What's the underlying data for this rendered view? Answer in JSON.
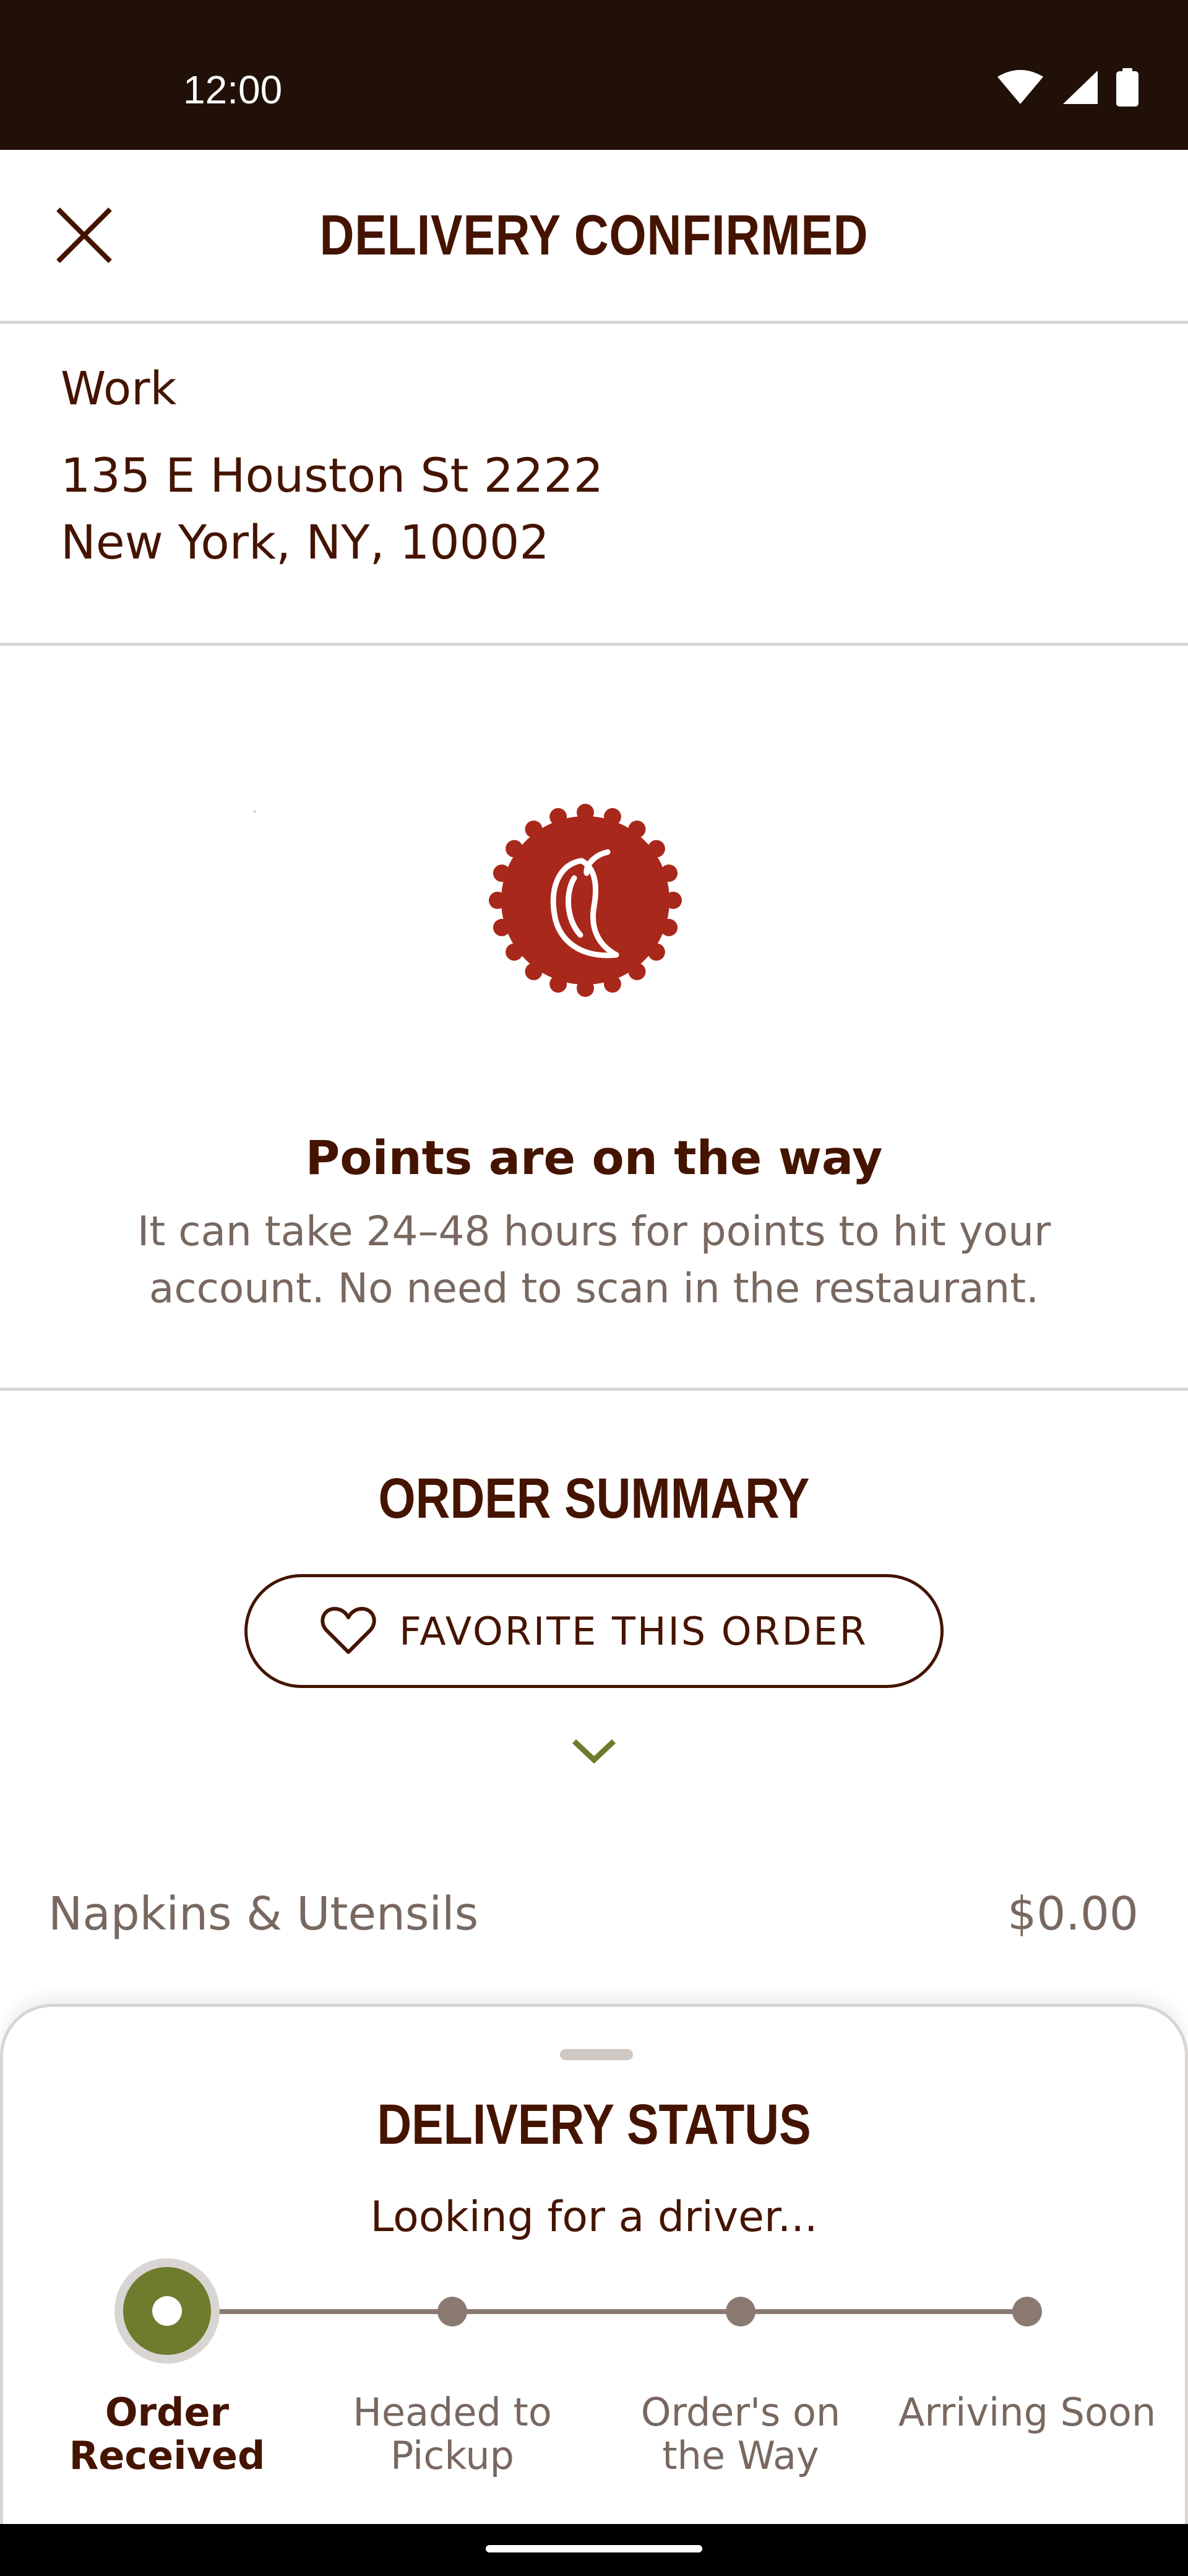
{
  "status_bar": {
    "time": "12:00",
    "icons": [
      "wifi-icon",
      "cell-signal-icon",
      "battery-icon"
    ]
  },
  "header": {
    "title": "DELIVERY CONFIRMED",
    "close_icon": "close-icon"
  },
  "address": {
    "label": "Work",
    "line1": "135 E Houston St 2222",
    "line2": "New York, NY, 10002"
  },
  "points": {
    "badge_icon": "chili-pepper-badge-icon",
    "title": "Points are on the way",
    "body": "It can take 24–48 hours for points to hit your account. No need to scan in the restaurant."
  },
  "order_summary": {
    "title": "ORDER SUMMARY",
    "favorite_button": "FAVORITE THIS ORDER",
    "favorite_icon": "heart-icon",
    "expand_icon": "chevron-down-icon",
    "items": [
      {
        "name": "Napkins & Utensils",
        "price": "$0.00"
      }
    ]
  },
  "delivery_status": {
    "title": "DELIVERY STATUS",
    "subtitle": "Looking for a driver...",
    "steps": [
      {
        "label": "Order Received",
        "active": true
      },
      {
        "label": "Headed to Pickup",
        "active": false
      },
      {
        "label": "Order's on the Way",
        "active": false
      },
      {
        "label": "Arriving Soon",
        "active": false
      }
    ]
  },
  "colors": {
    "brand_brown": "#451400",
    "status_bar": "#201008",
    "muted_text": "#786860",
    "active_green": "#6d7c2d",
    "badge_red": "#a8281b",
    "divider": "#d9d5d2"
  }
}
